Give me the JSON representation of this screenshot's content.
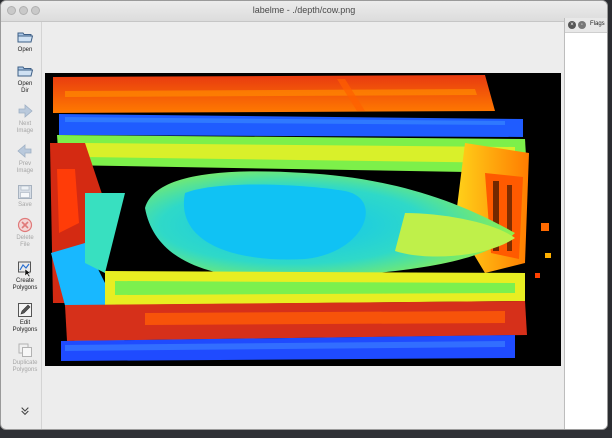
{
  "window": {
    "title": "labelme - ./depth/cow.png"
  },
  "toolbar": {
    "items": [
      {
        "label": "Open",
        "icon": "folder-icon",
        "enabled": true
      },
      {
        "label": "Open Dir",
        "icon": "folder-icon",
        "enabled": true
      },
      {
        "label": "Next Image",
        "icon": "arrow-right-icon",
        "enabled": false
      },
      {
        "label": "Prev Image",
        "icon": "arrow-left-icon",
        "enabled": false
      },
      {
        "label": "Save",
        "icon": "floppy-icon",
        "enabled": false
      },
      {
        "label": "Delete File",
        "icon": "delete-icon",
        "enabled": false
      },
      {
        "label": "Create Polygons",
        "icon": "polygon-icon",
        "enabled": true
      },
      {
        "label": "Edit Polygons",
        "icon": "edit-icon",
        "enabled": true
      },
      {
        "label": "Duplicate Polygons",
        "icon": "duplicate-icon",
        "enabled": false
      }
    ],
    "more_icon": "double-chevron-down-icon"
  },
  "dock": {
    "title": "Flags"
  },
  "colors": {
    "red": "#d12a10",
    "orange": "#ff6a00",
    "yellow": "#f2ee1a",
    "green": "#5ef07a",
    "cyan": "#10c8f0",
    "blue": "#1f4bff",
    "black": "#000000"
  }
}
